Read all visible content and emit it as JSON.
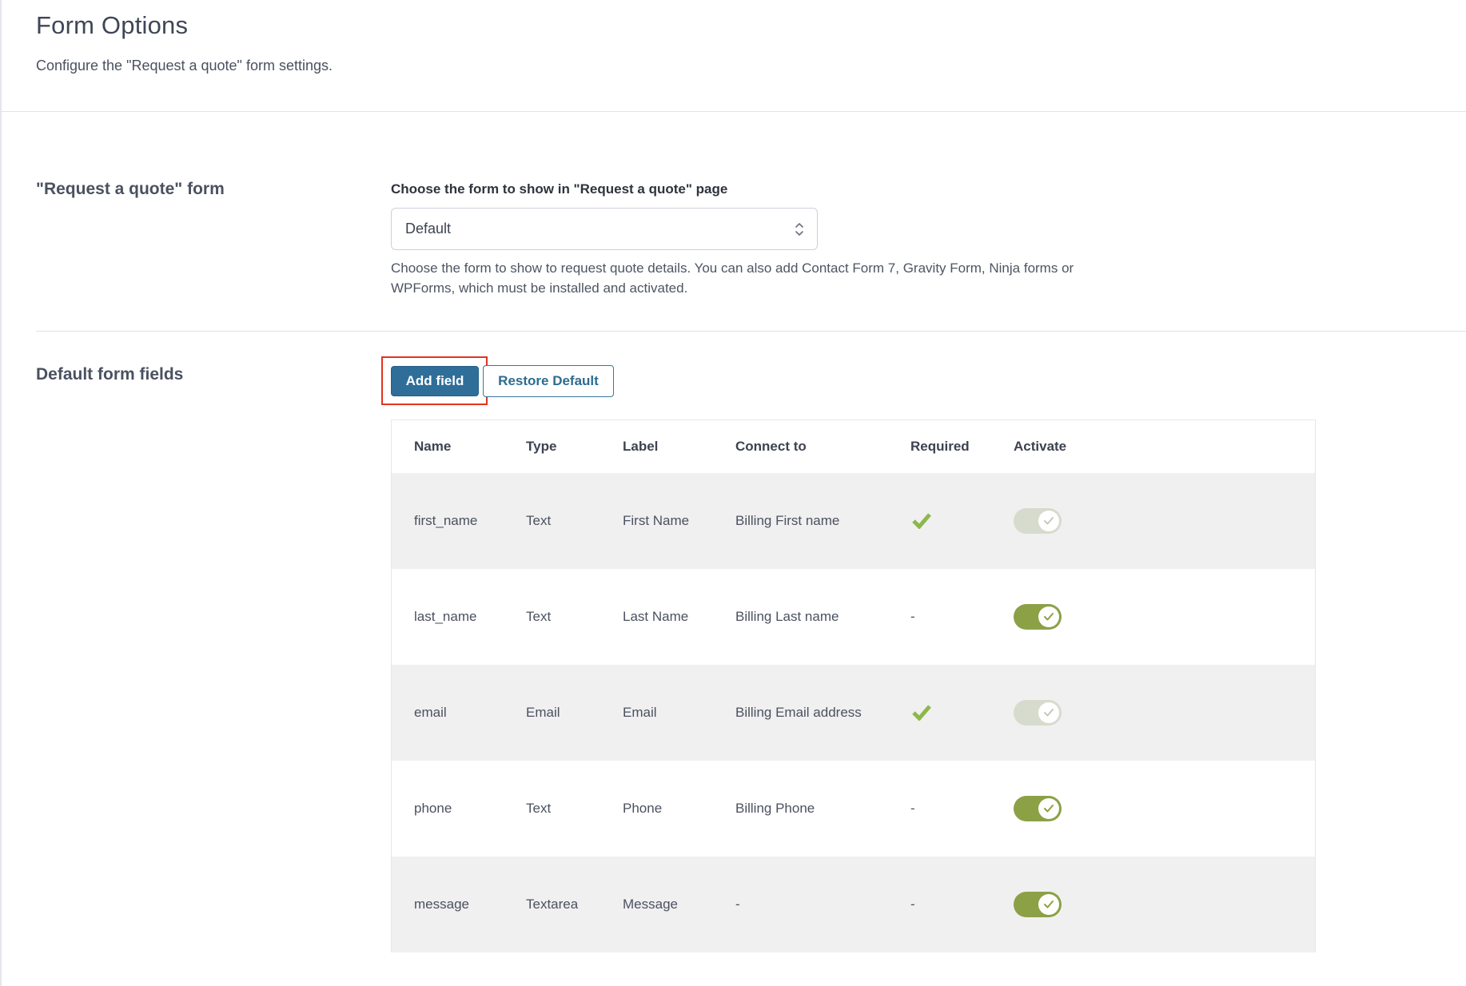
{
  "header": {
    "title": "Form Options",
    "description": "Configure the \"Request a quote\" form settings."
  },
  "quote_form": {
    "section_label": "\"Request a quote\" form",
    "field_title": "Choose the form to show in \"Request a quote\" page",
    "select_value": "Default",
    "help_text": "Choose the form to show to request quote details. You can also add Contact Form 7, Gravity Form, Ninja forms or WPForms, which must be installed and activated."
  },
  "default_fields": {
    "section_label": "Default form fields",
    "add_button": "Add field",
    "restore_button": "Restore Default",
    "columns": [
      "Name",
      "Type",
      "Label",
      "Connect to",
      "Required",
      "Activate"
    ],
    "rows": [
      {
        "name": "first_name",
        "type": "Text",
        "label": "First Name",
        "connect_to": "Billing First name",
        "required": "check",
        "activate": "on-disabled"
      },
      {
        "name": "last_name",
        "type": "Text",
        "label": "Last Name",
        "connect_to": "Billing Last name",
        "required": "-",
        "activate": "on"
      },
      {
        "name": "email",
        "type": "Email",
        "label": "Email",
        "connect_to": "Billing Email address",
        "required": "check",
        "activate": "on-disabled"
      },
      {
        "name": "phone",
        "type": "Text",
        "label": "Phone",
        "connect_to": "Billing Phone",
        "required": "-",
        "activate": "on"
      },
      {
        "name": "message",
        "type": "Textarea",
        "label": "Message",
        "connect_to": "-",
        "required": "-",
        "activate": "on"
      }
    ]
  },
  "colors": {
    "primary_button": "#2f6e99",
    "toggle_on": "#8ca046",
    "toggle_disabled": "#d6dbcd",
    "check": "#8cb84a",
    "highlight": "#e2331f"
  }
}
